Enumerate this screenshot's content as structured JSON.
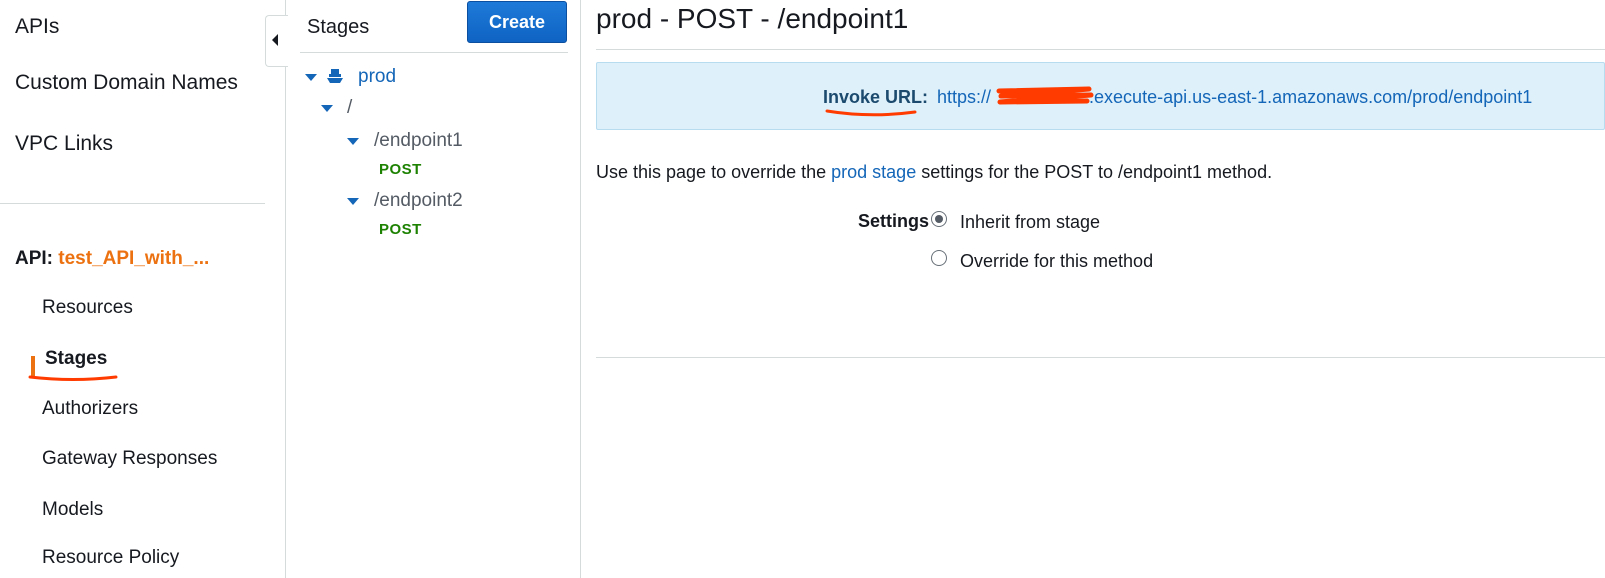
{
  "left_nav": {
    "top_items": [
      {
        "label": "APIs"
      },
      {
        "label": "Custom Domain Names"
      },
      {
        "label": "VPC Links"
      }
    ],
    "api_prefix": "API:",
    "api_name": "test_API_with_...",
    "sub_items": [
      {
        "label": "Resources"
      },
      {
        "label": "Stages"
      },
      {
        "label": "Authorizers"
      },
      {
        "label": "Gateway Responses"
      },
      {
        "label": "Models"
      },
      {
        "label": "Resource Policy"
      }
    ],
    "active_item": "Stages"
  },
  "stages_panel": {
    "title": "Stages",
    "create_label": "Create",
    "tree": {
      "stage": "prod",
      "root": "/",
      "resources": [
        {
          "path": "/endpoint1",
          "method": "POST"
        },
        {
          "path": "/endpoint2",
          "method": "POST"
        }
      ]
    }
  },
  "main": {
    "title": "prod - POST - /endpoint1",
    "invoke_label": "Invoke URL:",
    "invoke_url_prefix": "https://",
    "invoke_url_suffix": ".execute-api.us-east-1.amazonaws.com/prod/endpoint1",
    "description_before": "Use this page to override the ",
    "description_link": "prod stage",
    "description_after": " settings for the POST to /endpoint1 method.",
    "settings_label": "Settings",
    "options": [
      {
        "label": "Inherit from stage",
        "checked": true
      },
      {
        "label": "Override for this method",
        "checked": false
      }
    ]
  },
  "colors": {
    "accent_orange": "#ec7211",
    "link_blue": "#1466b8",
    "method_green": "#1d8102",
    "info_bg": "#def0fa",
    "button_blue": "#0f63c3",
    "annotation_red": "#ff3b00"
  }
}
